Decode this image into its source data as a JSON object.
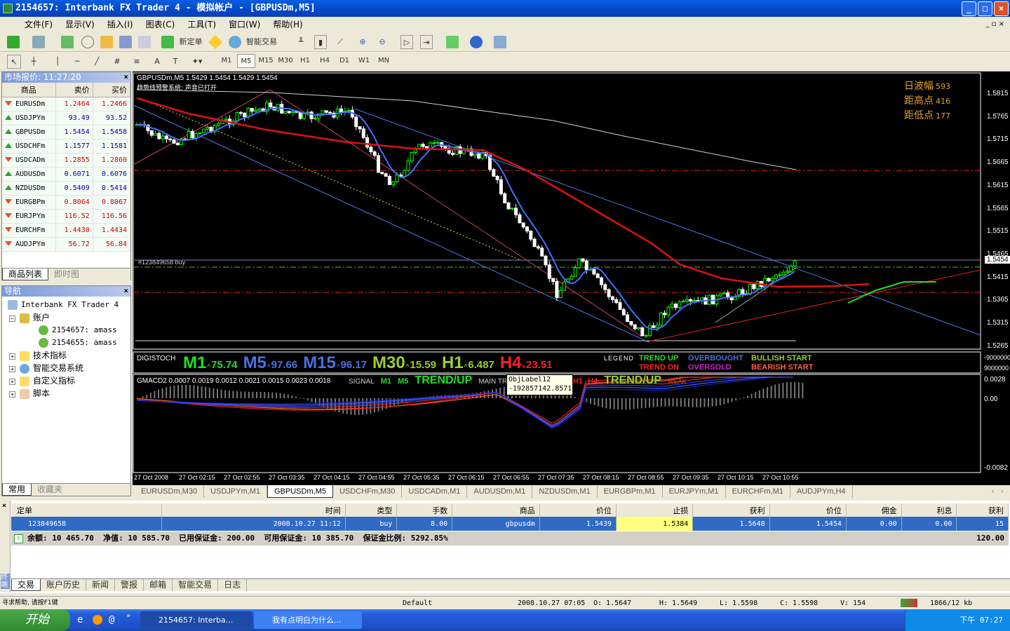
{
  "window": {
    "title": "2154657: Interbank FX Trader 4 - 模拟帐户 - [GBPUSDm,M5]",
    "buttons": [
      "minimize",
      "maximize",
      "close"
    ]
  },
  "menu": [
    "文件(F)",
    "显示(V)",
    "插入(I)",
    "图表(C)",
    "工具(T)",
    "窗口(W)",
    "帮助(H)"
  ],
  "toolbar": {
    "new_order": "新定单",
    "expert_advisors": "智能交易"
  },
  "timeframes": [
    "M1",
    "M5",
    "M15",
    "M30",
    "H1",
    "H4",
    "D1",
    "W1",
    "MN"
  ],
  "timeframe_selected": "M5",
  "market_watch": {
    "title": "市场报价: 11:27:20",
    "headers": [
      "商品",
      "卖价",
      "买价"
    ],
    "rows": [
      {
        "symbol": "EURUSDm",
        "bid": "1.2464",
        "ask": "1.2466",
        "dir": "down"
      },
      {
        "symbol": "USDJPYm",
        "bid": "93.49",
        "ask": "93.52",
        "dir": "up"
      },
      {
        "symbol": "GBPUSDm",
        "bid": "1.5454",
        "ask": "1.5458",
        "dir": "up"
      },
      {
        "symbol": "USDCHFm",
        "bid": "1.1577",
        "ask": "1.1581",
        "dir": "up"
      },
      {
        "symbol": "USDCADm",
        "bid": "1.2855",
        "ask": "1.2860",
        "dir": "down"
      },
      {
        "symbol": "AUDUSDm",
        "bid": "0.6071",
        "ask": "0.6076",
        "dir": "up"
      },
      {
        "symbol": "NZDUSDm",
        "bid": "0.5409",
        "ask": "0.5414",
        "dir": "up"
      },
      {
        "symbol": "EURGBPm",
        "bid": "0.8064",
        "ask": "0.8067",
        "dir": "down"
      },
      {
        "symbol": "EURJPYm",
        "bid": "116.52",
        "ask": "116.56",
        "dir": "down"
      },
      {
        "symbol": "EURCHFm",
        "bid": "1.4430",
        "ask": "1.4434",
        "dir": "down"
      },
      {
        "symbol": "AUDJPYm",
        "bid": "56.72",
        "ask": "56.84",
        "dir": "down"
      }
    ],
    "tabs": [
      "商品列表",
      "即时图"
    ]
  },
  "navigator": {
    "title": "导航",
    "root": "Interbank FX Trader 4",
    "accounts_label": "账户",
    "accounts": [
      "2154657: amass",
      "2154655: amass"
    ],
    "items": [
      "技术指标",
      "智能交易系统",
      "自定义指标",
      "脚本"
    ],
    "tabs": [
      "常用",
      "收藏夹"
    ]
  },
  "chart": {
    "header": "GBPUSDm,M5  1.5429 1.5454 1.5429 1.5454",
    "alert_line": "趋势线预警系统: 声音已打开",
    "info": [
      {
        "label": "日波幅",
        "value": "593"
      },
      {
        "label": "距高点",
        "value": "416"
      },
      {
        "label": "距低点",
        "value": "177"
      }
    ],
    "order_label": "#123849658 buy",
    "current_price": "1.5454",
    "price_ticks": [
      "1.5815",
      "1.5765",
      "1.5715",
      "1.5665",
      "1.5615",
      "1.5565",
      "1.5515",
      "1.5465",
      "1.5415",
      "1.5365",
      "1.5315",
      "1.5265"
    ],
    "time_ticks": [
      "27 Oct 2008",
      "27 Oct 02:15",
      "27 Oct 02:55",
      "27 Oct 03:35",
      "27 Oct 04:15",
      "27 Oct 04:55",
      "27 Oct 05:35",
      "27 Oct 06:15",
      "27 Oct 06:55",
      "27 Oct 07:35",
      "27 Oct 08:15",
      "27 Oct 08:55",
      "27 Oct 09:35",
      "27 Oct 10:15",
      "27 Oct 10:55"
    ],
    "colors": {
      "bull": "#00ff00",
      "bear": "#ffffff",
      "ma_red": "#e01010",
      "ma_blue": "#4070ff",
      "ma_white": "#d0d0d0"
    }
  },
  "digistoch": {
    "label": "DIGISTOCH",
    "tfs": [
      {
        "tf": "M1",
        "value": "75.74",
        "color": "#20e020",
        "arrow": "^"
      },
      {
        "tf": "M5",
        "value": "97.66",
        "color": "#4a70e0",
        "arrow": "^"
      },
      {
        "tf": "M15",
        "value": "96.17",
        "color": "#4a70e0",
        "arrow": "^"
      },
      {
        "tf": "M30",
        "value": "15.59",
        "color": "#9acd32",
        "arrow": "^"
      },
      {
        "tf": "H1",
        "value": "6.487",
        "color": "#9acd32",
        "arrow": "^"
      },
      {
        "tf": "H4",
        "value": "23.51",
        "color": "#ff2020",
        "arrow": "v"
      }
    ],
    "legend_label": "LEGEND",
    "legend": [
      [
        "TREND UP",
        "#20e020"
      ],
      [
        "TREND DN",
        "#ff2020"
      ],
      [
        "OVERBOUGHT",
        "#4a70e0"
      ],
      [
        "OVERSOLD",
        "#d020d0"
      ],
      [
        "BULLISH START",
        "#9acd32"
      ],
      [
        "BEARISH START",
        "#ff6040"
      ]
    ],
    "axis": [
      "-9000000",
      "9000000"
    ]
  },
  "gmacd": {
    "header": "GMACD2 0.0007 0.0019 0.0012 0.0021 0.0015 0.0023 0.0018",
    "signal": "SIGNAL",
    "m1": "M1",
    "m5": "M5",
    "trend1": "TREND/UP",
    "main": "MAIN TR",
    "h1": "H1",
    "h4": "H4",
    "trend2": "TREND/UP",
    "weak": "WEAK",
    "axis": [
      "0.0028",
      "0.00",
      "-0.0082"
    ]
  },
  "tooltip": {
    "line1": "ObjLabel12",
    "line2": "-192857142.8571"
  },
  "chart_tabs": [
    "EURUSDm,M30",
    "USDJPYm,M1",
    "GBPUSDm,M5",
    "USDCHFm,M30",
    "USDCADm,M1",
    "AUDUSDm,M1",
    "NZDUSDm,M1",
    "EURGBPm,M1",
    "EURJPYm,M1",
    "EURCHFm,M1",
    "AUDJPYm,H4"
  ],
  "chart_tab_active": "GBPUSDm,M5",
  "terminal": {
    "headers": [
      "定单",
      "时间",
      "类型",
      "手数",
      "商品",
      "价位",
      "止损",
      "获利",
      "价位",
      "佣金",
      "利息",
      "获利"
    ],
    "orders": [
      [
        "123849658",
        "2008.10.27 11:12",
        "buy",
        "8.00",
        "gbpusdm",
        "1.5439",
        "1.5384",
        "1.5648",
        "1.5454",
        "0.00",
        "0.00",
        "15"
      ]
    ],
    "balance": "余额: 10 465.70  净值: 10 585.70  已用保证金: 200.00  可用保证金: 10 385.70  保证金比例: 5292.85%",
    "total": "120.00",
    "tabs": [
      "交易",
      "账户历史",
      "新闻",
      "警报",
      "邮箱",
      "智能交易",
      "日志"
    ],
    "side_label": "终端"
  },
  "status": {
    "help": "寻求帮助, 请按F1键",
    "profile": "Default",
    "datetime": "2008.10.27 07:05",
    "open": "O: 1.5647",
    "high": "H: 1.5649",
    "low": "L: 1.5598",
    "close": "C: 1.5598",
    "volume": "V: 154",
    "traffic": "1866/12 kb"
  },
  "taskbar": {
    "start": "开始",
    "tasks": [
      "2154657: Interba...",
      "我有点明白为什么..."
    ],
    "clock": "下午 07:27"
  }
}
